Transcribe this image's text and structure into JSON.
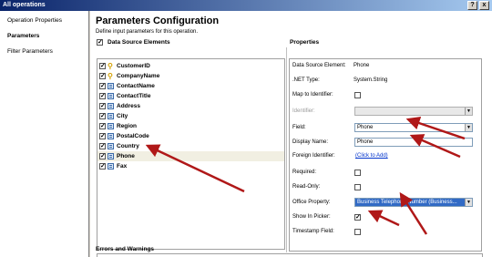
{
  "window": {
    "title": "All operations",
    "help_glyph": "?",
    "close_glyph": "x"
  },
  "nav": {
    "items": [
      "Operation Properties",
      "Parameters",
      "Filter Parameters"
    ]
  },
  "page": {
    "title": "Parameters Configuration",
    "description": "Define input parameters for this operation."
  },
  "data_source": {
    "header": "Data Source Elements",
    "fields": [
      {
        "label": "CustomerID",
        "icon": "key-icon"
      },
      {
        "label": "CompanyName",
        "icon": "key-icon"
      },
      {
        "label": "ContactName",
        "icon": "column-icon"
      },
      {
        "label": "ContactTitle",
        "icon": "column-icon"
      },
      {
        "label": "Address",
        "icon": "column-icon"
      },
      {
        "label": "City",
        "icon": "column-icon"
      },
      {
        "label": "Region",
        "icon": "column-icon"
      },
      {
        "label": "PostalCode",
        "icon": "column-icon"
      },
      {
        "label": "Country",
        "icon": "column-icon"
      },
      {
        "label": "Phone",
        "icon": "column-icon"
      },
      {
        "label": "Fax",
        "icon": "column-icon"
      }
    ]
  },
  "properties": {
    "header": "Properties",
    "data_source_element": {
      "label": "Data Source Element:",
      "value": "Phone"
    },
    "net_type": {
      "label": ".NET Type:",
      "value": "System.String"
    },
    "map_to_identifier": {
      "label": "Map to Identifier:"
    },
    "identifier": {
      "label": "Identifier:"
    },
    "field": {
      "label": "Field:",
      "value": "Phone"
    },
    "display_name": {
      "label": "Display Name:",
      "value": "Phone"
    },
    "foreign_identifier": {
      "label": "Foreign Identifier:",
      "link": "(Click to Add)"
    },
    "required": {
      "label": "Required:"
    },
    "read_only": {
      "label": "Read-Only:"
    },
    "office_property": {
      "label": "Office Property:",
      "value": "Business Telephone Number (Business..."
    },
    "show_in_picker": {
      "label": "Show In Picker:"
    },
    "timestamp_field": {
      "label": "Timestamp Field:"
    }
  },
  "errors": {
    "header": "Errors and Warnings"
  },
  "colors": {
    "arrow": "#b01818",
    "title_bar": "#0a246a",
    "selection": "#316ac5"
  }
}
